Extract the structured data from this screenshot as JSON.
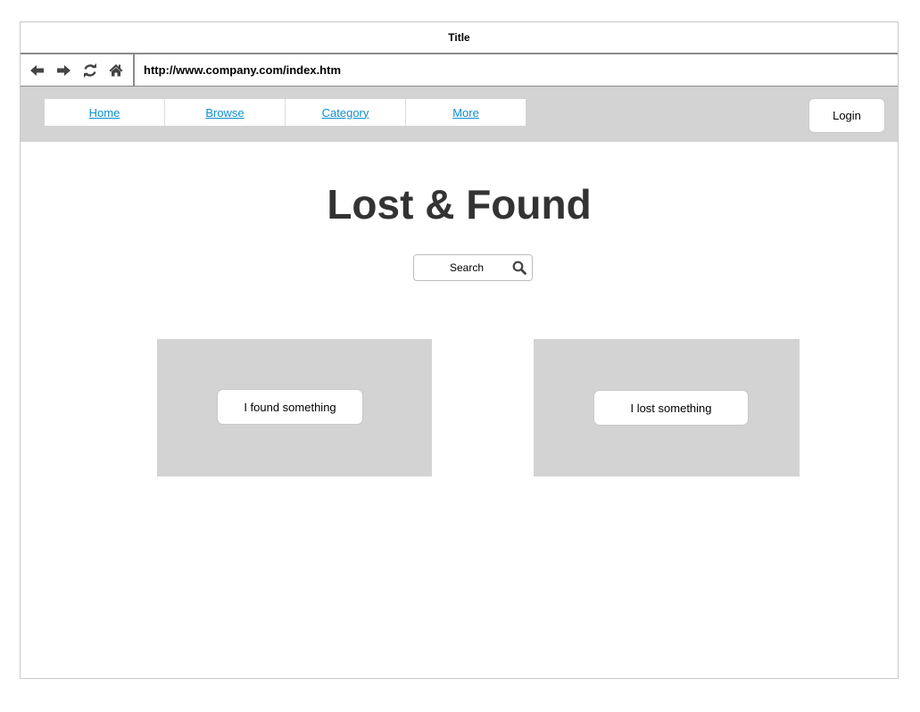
{
  "window": {
    "title": "Title"
  },
  "browser": {
    "url": "http://www.company.com/index.htm",
    "buttons": [
      "back-arrow-icon",
      "forward-arrow-icon",
      "refresh-icon",
      "home-icon"
    ]
  },
  "nav": {
    "tabs": [
      {
        "label": "Home"
      },
      {
        "label": "Browse"
      },
      {
        "label": "Category"
      },
      {
        "label": "More"
      }
    ],
    "login_label": "Login"
  },
  "main": {
    "headline": "Lost & Found",
    "search": {
      "value": "Search",
      "icon": "magnifier-icon"
    },
    "cards": [
      {
        "button_label": "I found something"
      },
      {
        "button_label": "I lost something"
      }
    ]
  },
  "colors": {
    "link": "#0e90d2",
    "panel": "#d3d3d3",
    "headline": "#333333"
  }
}
